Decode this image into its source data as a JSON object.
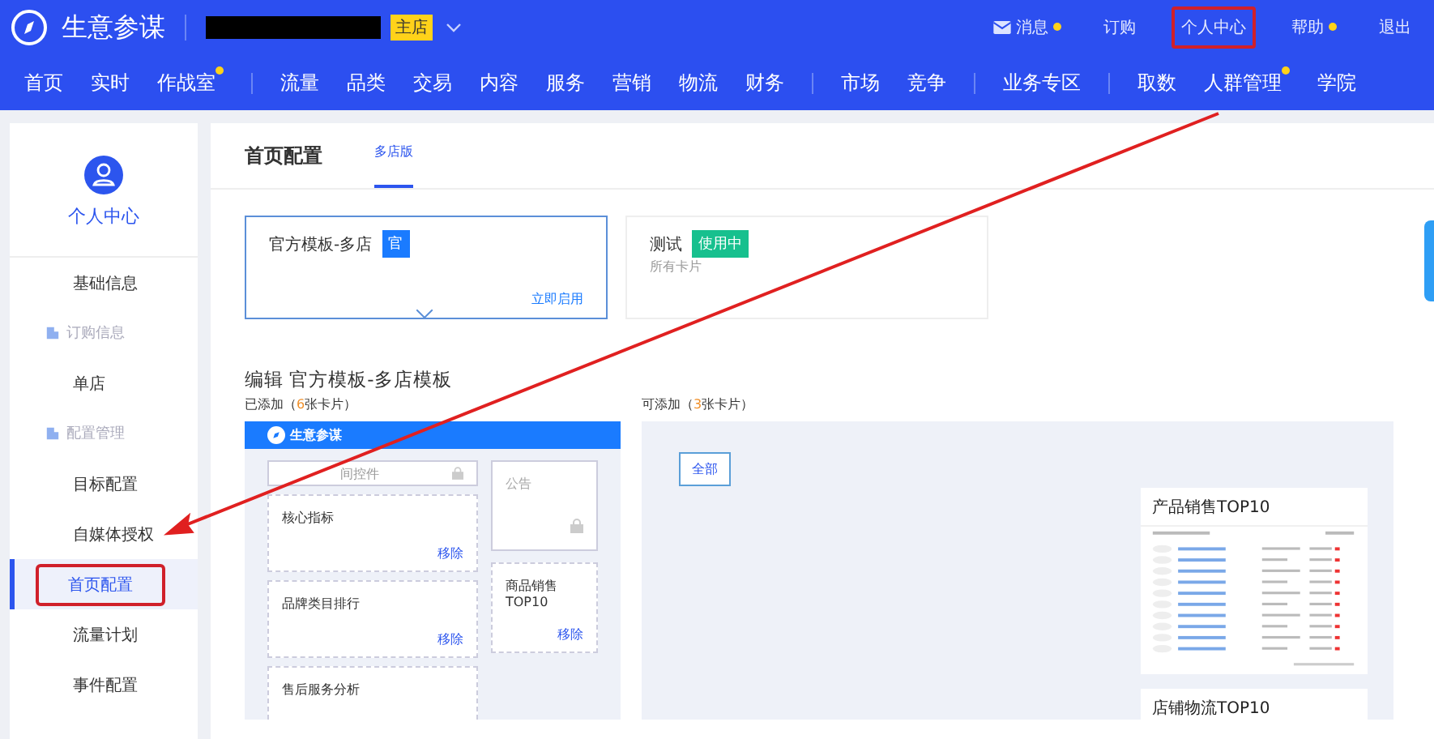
{
  "header": {
    "logo": "生意参谋",
    "shop_badge": "主店",
    "links": [
      {
        "label": "消息",
        "kind": "mail",
        "dot": true,
        "highlighted": false
      },
      {
        "label": "订购",
        "kind": "text",
        "dot": false,
        "highlighted": false
      },
      {
        "label": "个人中心",
        "kind": "text",
        "dot": false,
        "highlighted": true
      },
      {
        "label": "帮助",
        "kind": "text",
        "dot": true,
        "highlighted": false
      },
      {
        "label": "退出",
        "kind": "text",
        "dot": false,
        "highlighted": false
      }
    ]
  },
  "nav": [
    [
      {
        "label": "首页",
        "dot": false
      },
      {
        "label": "实时",
        "dot": false
      },
      {
        "label": "作战室",
        "dot": true
      }
    ],
    [
      {
        "label": "流量",
        "dot": false
      },
      {
        "label": "品类",
        "dot": false
      },
      {
        "label": "交易",
        "dot": false
      },
      {
        "label": "内容",
        "dot": false
      },
      {
        "label": "服务",
        "dot": false
      },
      {
        "label": "营销",
        "dot": false
      },
      {
        "label": "物流",
        "dot": false
      },
      {
        "label": "财务",
        "dot": false
      }
    ],
    [
      {
        "label": "市场",
        "dot": false
      },
      {
        "label": "竞争",
        "dot": false
      }
    ],
    [
      {
        "label": "业务专区",
        "dot": false
      }
    ],
    [
      {
        "label": "取数",
        "dot": false
      },
      {
        "label": "人群管理",
        "dot": true
      },
      {
        "label": "学院",
        "dot": false
      }
    ]
  ],
  "sidebar": {
    "title": "个人中心",
    "items": [
      {
        "label": "基础信息",
        "kind": "item",
        "selected": false,
        "highlighted": false
      },
      {
        "label": "订购信息",
        "kind": "group"
      },
      {
        "label": "单店",
        "kind": "item",
        "selected": false,
        "highlighted": false
      },
      {
        "label": "配置管理",
        "kind": "group"
      },
      {
        "label": "目标配置",
        "kind": "item",
        "selected": false,
        "highlighted": false
      },
      {
        "label": "自媒体授权",
        "kind": "item",
        "selected": false,
        "highlighted": false
      },
      {
        "label": "首页配置",
        "kind": "item",
        "selected": true,
        "highlighted": true
      },
      {
        "label": "流量计划",
        "kind": "item",
        "selected": false,
        "highlighted": false
      },
      {
        "label": "事件配置",
        "kind": "item",
        "selected": false,
        "highlighted": false
      }
    ]
  },
  "page": {
    "title": "首页配置",
    "tabs": [
      {
        "label": "多店版",
        "selected": true
      }
    ],
    "templates": [
      {
        "name": "官方模板-多店",
        "badge": "官",
        "color": "#1a7bff",
        "action": "立即启用",
        "selected": true
      },
      {
        "name": "测试",
        "badge": "使用中",
        "color": "#17c08e",
        "subtitle": "所有卡片",
        "selected": false
      }
    ],
    "editor_title": "编辑 官方模板-多店模板",
    "added": {
      "prefix": "已添加（",
      "count": "6",
      "suffix": "张卡片）"
    },
    "available": {
      "prefix": "可添加（",
      "count": "3",
      "suffix": "张卡片）"
    },
    "preview": {
      "brand": "生意参谋",
      "left": [
        {
          "title": "间控件",
          "kind": "locked-field"
        },
        {
          "title": "核心指标",
          "kind": "removable",
          "action": "移除"
        },
        {
          "title": "品牌类目排行",
          "kind": "removable",
          "action": "移除"
        },
        {
          "title": "售后服务分析",
          "kind": "removable"
        }
      ],
      "right": [
        {
          "title": "公告",
          "kind": "locked"
        },
        {
          "title": "商品销售TOP10",
          "kind": "removable",
          "action": "移除"
        }
      ]
    },
    "filter": "全部",
    "cards": [
      {
        "title": "产品销售TOP10",
        "kind": "table-preview"
      },
      {
        "title": "店铺物流TOP10",
        "kind": "plain"
      }
    ]
  }
}
